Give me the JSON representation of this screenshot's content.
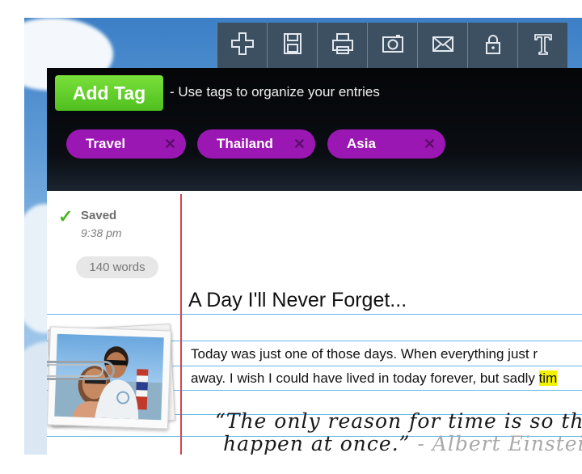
{
  "toolbar": {
    "buttons": [
      {
        "icon": "plus-icon"
      },
      {
        "icon": "floppy-disk-icon"
      },
      {
        "icon": "printer-icon"
      },
      {
        "icon": "camera-icon"
      },
      {
        "icon": "envelope-icon"
      },
      {
        "icon": "lock-icon"
      },
      {
        "icon": "text-format-icon"
      }
    ]
  },
  "tags": {
    "add_label": "Add Tag",
    "hint": "- Use tags to organize your entries",
    "items": [
      {
        "label": "Travel",
        "remove": "✕"
      },
      {
        "label": "Thailand",
        "remove": "✕"
      },
      {
        "label": "Asia",
        "remove": "✕"
      }
    ],
    "color": "#9b17b3"
  },
  "status": {
    "check": "✓",
    "saved": "Saved",
    "time": "9:38 pm",
    "word_count": "140 words"
  },
  "entry": {
    "title": "A Day I'll Never Forget...",
    "line1": "Today was just one of those days. When everything just r",
    "line2_before": "away. I wish I could have lived in today forever, but sadly ",
    "line2_highlight": "tim",
    "quote_line1": "“The only reason for time is so th",
    "quote_line2": "happen at once.”",
    "quote_author": " - Albert Einstei"
  },
  "colors": {
    "toolbar_bg": "#3d5061",
    "add_tag_green": "#5ccc2a",
    "margin_red": "#d9424a",
    "rule_blue": "#62b8e8",
    "highlight": "#f2f200"
  }
}
